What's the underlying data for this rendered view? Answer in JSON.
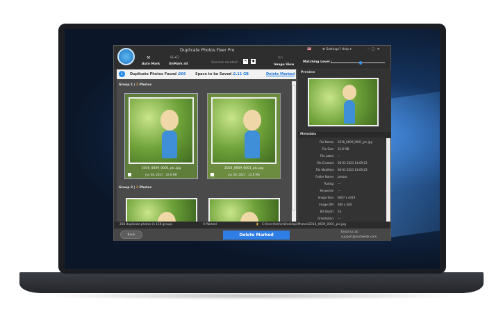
{
  "app": {
    "title": "Duplicate Photos Fixer Pro",
    "settings": "Settings",
    "help": "Help"
  },
  "toolbar": {
    "auto_mark": "Auto Mark",
    "unmark_all": "UnMark all",
    "selection_assistant": "Selection Assistant",
    "image_view": "Image View",
    "matching_level": "Matching Level :",
    "matching_value": 0.55
  },
  "info": {
    "found_label": "Duplicate Photos Found :",
    "found_value": "266",
    "space_label": "Space to be Saved :",
    "space_value": "2.11 GB",
    "delete_link": "Delete Marked"
  },
  "groups": [
    {
      "label": "Group 1",
      "count": "2",
      "suffix": "Photos",
      "photos": [
        {
          "name": "2016_0609_0001_pic.jpg",
          "date": "Jan 08, 2021",
          "size": "32.8 MB"
        },
        {
          "name": "2016_0609_0001_pic.jpg",
          "date": "Jan 08, 2021",
          "size": "32.8 MB"
        }
      ]
    },
    {
      "label": "Group 2",
      "count": "2",
      "suffix": "Photos"
    }
  ],
  "preview": {
    "label": "Preview"
  },
  "metadata": {
    "label": "Metadata",
    "rows": [
      {
        "k": "File Name:",
        "v": "2016_0609_0001_pic.jpg"
      },
      {
        "k": "File Size:",
        "v": "32.8 MB"
      },
      {
        "k": "File Label:",
        "v": "---"
      },
      {
        "k": "File Created:",
        "v": "08-01-2021 14:09:23"
      },
      {
        "k": "File Modified:",
        "v": "08-01-2021 14:09:23"
      },
      {
        "k": "Folder Name:",
        "v": "photos"
      },
      {
        "k": "Rating:",
        "v": "---"
      },
      {
        "k": "Keywords:",
        "v": "---"
      },
      {
        "k": "Image Size:",
        "v": "6607 x 4419"
      },
      {
        "k": "Image DPI:",
        "v": "300 x 300"
      },
      {
        "k": "Bit Depth:",
        "v": "24"
      },
      {
        "k": "Orientation:",
        "v": "---"
      }
    ]
  },
  "status": {
    "summary": "266 duplicate photos in 118 groups",
    "marked": "0 Marked",
    "path": "C:\\User\\Admin\\Desktop\\Photos\\2016_0609_0001_pic.jpg"
  },
  "bottom": {
    "back": "Back",
    "delete": "Delete Marked",
    "email_label": "Email us at:",
    "email": "support@systweak.com"
  }
}
